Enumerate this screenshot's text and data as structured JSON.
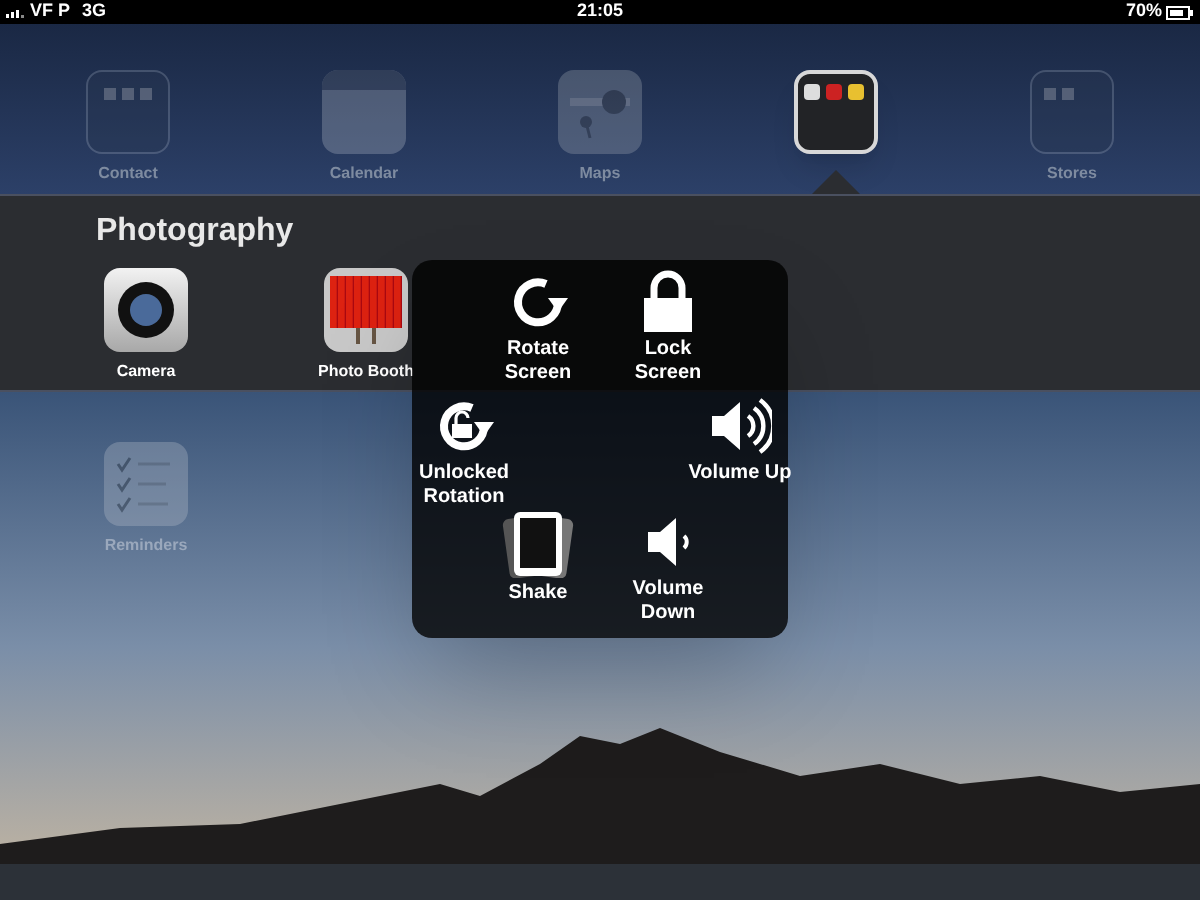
{
  "status_bar": {
    "carrier": "VF P",
    "network": "3G",
    "time": "21:05",
    "battery": "70%"
  },
  "home_row": [
    {
      "label": "Contact",
      "kind": "contacts",
      "selected": false
    },
    {
      "label": "Calendar",
      "kind": "calendar",
      "selected": false
    },
    {
      "label": "Maps",
      "kind": "maps",
      "selected": false
    },
    {
      "kind": "folder",
      "selected": true
    },
    {
      "label": "Stores",
      "kind": "stores",
      "selected": false
    }
  ],
  "folder": {
    "title": "Photography",
    "apps": [
      {
        "label": "Camera",
        "kind": "camera"
      },
      {
        "label": "Photo Booth",
        "kind": "booth"
      }
    ]
  },
  "lower_apps": [
    {
      "label": "Reminders",
      "kind": "reminders",
      "selected": false
    }
  ],
  "assistive_menu": {
    "items": [
      {
        "label": "Rotate Screen",
        "kind": "rotate"
      },
      {
        "label": "Lock Screen",
        "kind": "lock"
      },
      {
        "label": "Unlocked Rotation",
        "kind": "unlocked"
      },
      {
        "label": "Volume Up",
        "kind": "volup"
      },
      {
        "label": "Shake",
        "kind": "shake"
      },
      {
        "label": "Volume Down",
        "kind": "voldown"
      }
    ]
  }
}
